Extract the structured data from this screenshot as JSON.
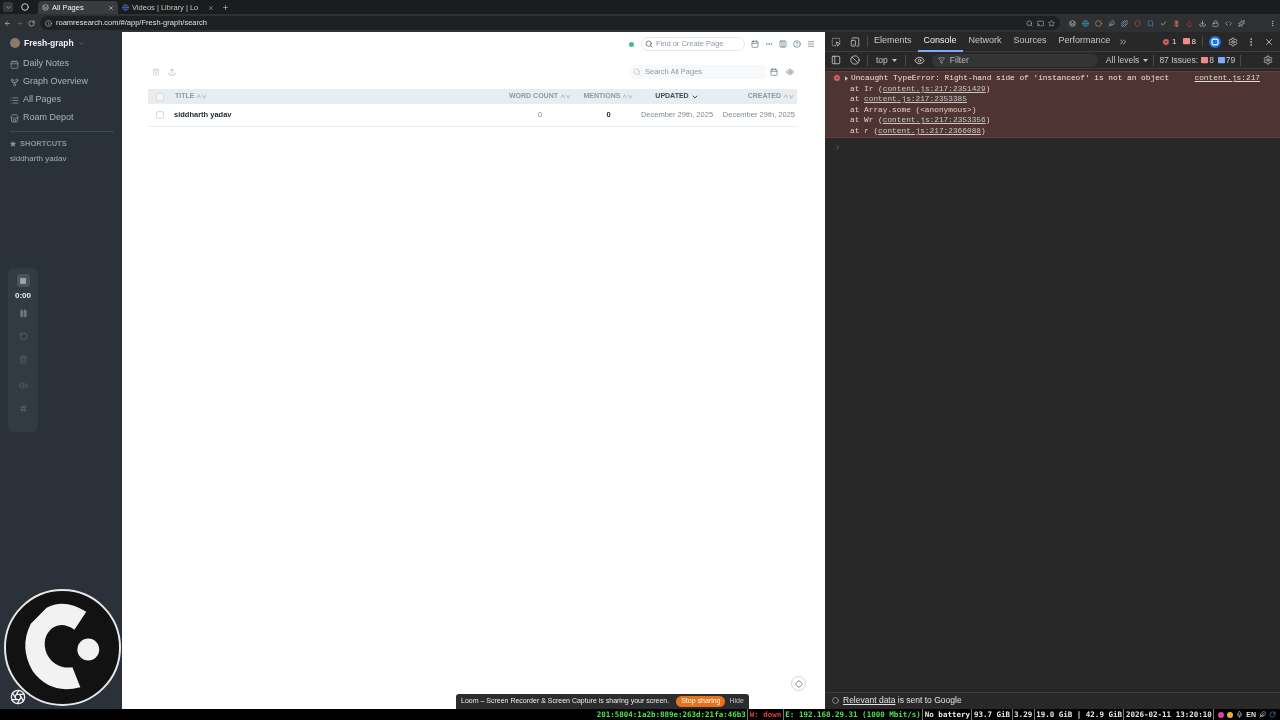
{
  "browser": {
    "tabs": [
      {
        "title": "All Pages",
        "selected": true
      },
      {
        "title": "Videos | Library | Lo",
        "selected": false
      }
    ],
    "url": "roamresearch.com/#/app/Fresh-graph/search"
  },
  "sidebar": {
    "graph_name": "Fresh-graph",
    "items": [
      {
        "label": "Daily Notes"
      },
      {
        "label": "Graph Overview"
      },
      {
        "label": "All Pages"
      },
      {
        "label": "Roam Depot"
      }
    ],
    "shortcuts_heading": "SHORTCUTS",
    "shortcuts": [
      {
        "label": "siddharth yadav"
      }
    ]
  },
  "recorder": {
    "timer": "0:00"
  },
  "topbar": {
    "search_placeholder": "Find or Create Page"
  },
  "all_pages": {
    "search_placeholder": "Search All Pages",
    "all_checked": false,
    "columns": [
      {
        "label": "TITLE",
        "sorted": false
      },
      {
        "label": "WORD COUNT",
        "sorted": false
      },
      {
        "label": "MENTIONS",
        "sorted": false
      },
      {
        "label": "UPDATED",
        "sorted": true
      },
      {
        "label": "CREATED",
        "sorted": false
      }
    ],
    "rows": [
      {
        "checked": false,
        "cells": [
          "siddharth yadav",
          "0",
          "0",
          "December 29th, 2025",
          "December 29th, 2025"
        ]
      }
    ]
  },
  "devtools": {
    "tabs": [
      {
        "label": "Elements",
        "selected": false
      },
      {
        "label": "Console",
        "selected": true
      },
      {
        "label": "Network",
        "selected": false
      },
      {
        "label": "Sources",
        "selected": false
      },
      {
        "label": "Performance",
        "selected": false
      }
    ],
    "error_count": "1",
    "warning_count": "8",
    "context": "top",
    "filter_placeholder": "Filter",
    "levels": "All levels",
    "issues_label": "87 Issues:",
    "issues_warnings": "8",
    "issues_info": "79",
    "messages": [
      {
        "kind": "error",
        "text": "Uncaught TypeError: Right-hand side of 'instanceof' is not an object",
        "source": "content.js:217",
        "stack": [
          {
            "text": "at Ir (",
            "link": "content.js:217:2351429",
            "tail": ")"
          },
          {
            "text": "at ",
            "link": "content.js:217:2353385"
          },
          {
            "text": "at Array.some (<anonymous>)"
          },
          {
            "text": "at Wr (",
            "link": "content.js:217:2353356",
            "tail": ")"
          },
          {
            "text": "at r (",
            "link": "content.js:217:2366088",
            "tail": ")"
          }
        ]
      }
    ],
    "notice": {
      "link": "Relevant data",
      "text": "is sent to Google"
    }
  },
  "screen_share": {
    "message": "Loom – Screen Recorder & Screen Capture is sharing your screen.",
    "stop": "Stop sharing",
    "hide": "Hide"
  },
  "status_bar": {
    "segments": [
      {
        "text": "201:5804:1a2b:889e:263d:21fa:46b3",
        "color": "#4ee44e"
      },
      {
        "text": "W: down",
        "color": "#e03c3c"
      },
      {
        "text": "E: 192.168.29.31 (1000 Mbit/s)",
        "color": "#4ee44e"
      },
      {
        "text": "No battery",
        "color": "#e8e8e8"
      },
      {
        "text": "93.7 GiB",
        "color": "#e8e8e8"
      },
      {
        "text": "3.29",
        "color": "#e8e8e8"
      },
      {
        "text": "19.0 GiB | 42.9 GiB",
        "color": "#e8e8e8"
      },
      {
        "text": "2026-02-11 13:20:10",
        "color": "#e8e8e8"
      }
    ],
    "input_language": "EN"
  }
}
